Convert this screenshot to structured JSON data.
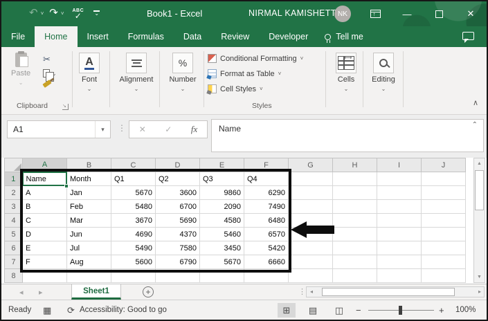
{
  "titlebar": {
    "title": "Book1 - Excel",
    "user": "NIRMAL KAMISHETTY",
    "initials": "NK",
    "abc": "ABC"
  },
  "tabs": {
    "file": "File",
    "home": "Home",
    "insert": "Insert",
    "formulas": "Formulas",
    "data": "Data",
    "review": "Review",
    "developer": "Developer",
    "tell_me": "Tell me"
  },
  "ribbon": {
    "paste": "Paste",
    "clipboard": "Clipboard",
    "font": "Font",
    "alignment": "Alignment",
    "number": "Number",
    "conditional_formatting": "Conditional Formatting",
    "format_as_table": "Format as Table",
    "cell_styles": "Cell Styles",
    "styles": "Styles",
    "cells": "Cells",
    "editing": "Editing"
  },
  "formula": {
    "name_box": "A1",
    "value": "Name",
    "fx": "fx"
  },
  "grid": {
    "columns": [
      "A",
      "B",
      "C",
      "D",
      "E",
      "F",
      "G",
      "H",
      "I",
      "J"
    ],
    "rows": [
      "1",
      "2",
      "3",
      "4",
      "5",
      "6",
      "7",
      "8"
    ],
    "data": [
      [
        "Name",
        "Month",
        "Q1",
        "Q2",
        "Q3",
        "Q4"
      ],
      [
        "A",
        "Jan",
        "5670",
        "3600",
        "9860",
        "6290"
      ],
      [
        "B",
        "Feb",
        "5480",
        "6700",
        "2090",
        "7490"
      ],
      [
        "C",
        "Mar",
        "3670",
        "5690",
        "4580",
        "6480"
      ],
      [
        "D",
        "Jun",
        "4690",
        "4370",
        "5460",
        "6570"
      ],
      [
        "E",
        "Jul",
        "5490",
        "7580",
        "3450",
        "5420"
      ],
      [
        "F",
        "Aug",
        "5600",
        "6790",
        "5670",
        "6660"
      ]
    ]
  },
  "sheetbar": {
    "sheet": "Sheet1"
  },
  "statusbar": {
    "ready": "Ready",
    "accessibility": "Accessibility: Good to go",
    "zoom": "100%"
  },
  "icons": {
    "undo": "↶",
    "redo": "↷",
    "minimize": "—",
    "close": "✕",
    "scissors": "✂",
    "chevron": "⌄",
    "chevron_small": "˅",
    "dropdown": "▾",
    "dots": "⋮",
    "cancel": "✕",
    "check": "✓",
    "expand_formula": "⌃",
    "collapse_ribbon": "∧",
    "launcher": "↘",
    "percent": "%",
    "font_a": "A",
    "left_tri": "◂",
    "right_tri": "▸",
    "up_tri": "▲",
    "down_tri": "▼",
    "plus": "+",
    "minus": "−",
    "normal_view": "⊞",
    "page_layout": "▤",
    "page_break": "◫",
    "macro": "▦",
    "accessibility": "⟳",
    "cells_resize": "⟷"
  },
  "colors": {
    "excel_green": "#217346",
    "dark_green": "#1e6b40",
    "annotation_black": "#0d0d0d"
  }
}
